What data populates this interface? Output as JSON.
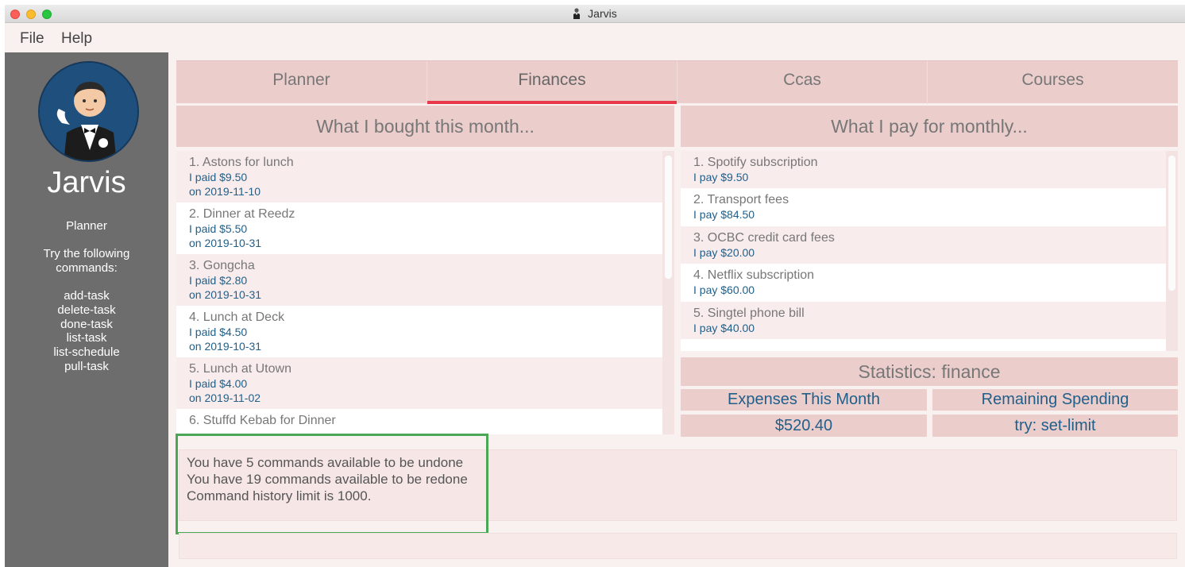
{
  "window": {
    "title": "Jarvis"
  },
  "menu": [
    "File",
    "Help"
  ],
  "sidebar": {
    "app_name": "Jarvis",
    "section": "Planner",
    "hint": "Try the following commands:",
    "commands": [
      "add-task",
      "delete-task",
      "done-task",
      "list-task",
      "list-schedule",
      "pull-task"
    ]
  },
  "tabs": [
    {
      "label": "Planner",
      "active": false
    },
    {
      "label": "Finances",
      "active": true
    },
    {
      "label": "Ccas",
      "active": false
    },
    {
      "label": "Courses",
      "active": false
    }
  ],
  "purchases": {
    "header": "What I bought this month...",
    "items": [
      {
        "name": "1. Astons for lunch",
        "paid": "I paid $9.50",
        "date": "on 2019-11-10"
      },
      {
        "name": "2. Dinner at Reedz",
        "paid": "I paid $5.50",
        "date": "on 2019-10-31"
      },
      {
        "name": "3. Gongcha",
        "paid": "I paid $2.80",
        "date": "on 2019-10-31"
      },
      {
        "name": "4. Lunch at Deck",
        "paid": "I paid $4.50",
        "date": "on 2019-10-31"
      },
      {
        "name": "5. Lunch at Utown",
        "paid": "I paid $4.00",
        "date": "on 2019-11-02"
      },
      {
        "name": "6. Stuffd Kebab for Dinner",
        "paid": "",
        "date": ""
      }
    ]
  },
  "instalments": {
    "header": "What I pay for monthly...",
    "items": [
      {
        "name": "1. Spotify subscription",
        "pay": "I pay $9.50"
      },
      {
        "name": "2. Transport fees",
        "pay": "I pay $84.50"
      },
      {
        "name": "3. OCBC credit card fees",
        "pay": "I pay $20.00"
      },
      {
        "name": "4. Netflix subscription",
        "pay": "I pay $60.00"
      },
      {
        "name": "5. Singtel phone bill",
        "pay": "I pay $40.00"
      }
    ]
  },
  "statistics": {
    "title": "Statistics: finance",
    "expenses_label": "Expenses This Month",
    "expenses_value": "$520.40",
    "remaining_label": "Remaining Spending",
    "remaining_value": "try: set-limit"
  },
  "result_display": {
    "lines": [
      "You have 5 commands available to be undone",
      "You have 19 commands available to be redone",
      "Command history limit is 1000."
    ]
  },
  "command_box": {
    "value": ""
  },
  "colors": {
    "accent": "#e8394a",
    "highlight": "#4aa755",
    "sidebar": "#6d6d6d",
    "tab": "#ebcdcc"
  }
}
